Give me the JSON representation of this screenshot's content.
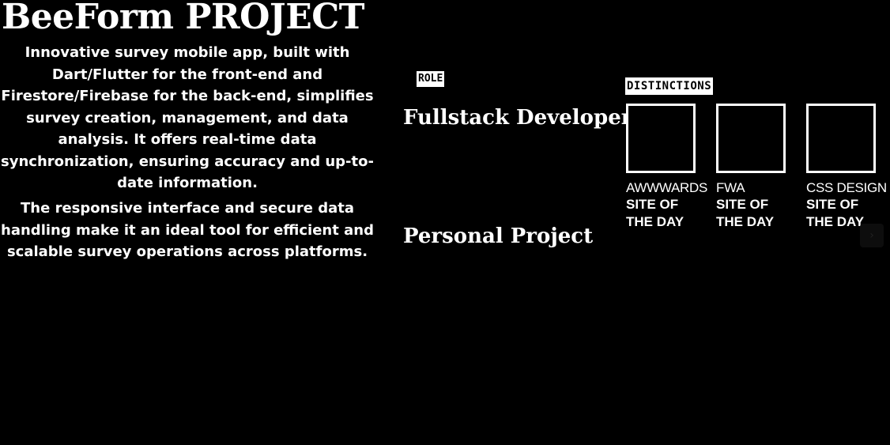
{
  "project": {
    "title": "BeeForm PROJECT",
    "description_1": "Innovative survey mobile app, built with Dart/Flutter for the front-end and Firestore/Firebase for the back-end, simplifies survey creation, management, and data analysis. It offers real-time data synchronization, ensuring accuracy and up-to-date information.",
    "description_2": "The responsive interface and secure data handling make it an ideal tool for efficient and scalable survey operations across platforms."
  },
  "role": {
    "label": "ROLE",
    "position": "Fullstack Developer",
    "type": "Personal Project"
  },
  "distinctions": {
    "label": "DISTINCTIONS",
    "items": [
      {
        "org": "AWWWARDS",
        "prize": "SITE OF THE DAY"
      },
      {
        "org": "FWA",
        "prize": "SITE OF THE DAY"
      },
      {
        "org": "CSS DESIGN",
        "prize": "SITE OF THE DAY"
      }
    ]
  },
  "controls": {
    "scroll_icon": "chevron-right-icon"
  }
}
